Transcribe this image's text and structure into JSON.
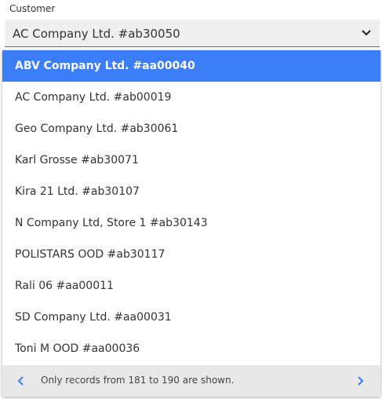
{
  "field": {
    "label": "Customer",
    "value": "AC Company Ltd. #ab30050"
  },
  "options": [
    {
      "label": "ABV Company Ltd. #aa00040",
      "selected": true
    },
    {
      "label": "AC Company Ltd. #ab00019",
      "selected": false
    },
    {
      "label": "Geo Company Ltd. #ab30061",
      "selected": false
    },
    {
      "label": "Karl Grosse #ab30071",
      "selected": false
    },
    {
      "label": "Kira 21 Ltd. #ab30107",
      "selected": false
    },
    {
      "label": "N Company Ltd, Store 1 #ab30143",
      "selected": false
    },
    {
      "label": "POLISTARS OOD #ab30117",
      "selected": false
    },
    {
      "label": "Rali 06 #aa00011",
      "selected": false
    },
    {
      "label": "SD Company Ltd. #aa00031",
      "selected": false
    },
    {
      "label": "Toni M OOD #aa00036",
      "selected": false
    }
  ],
  "footer": {
    "message": "Only records from 181 to 190 are shown."
  },
  "icons": {
    "dropdown": "chevron-down-icon",
    "prev": "chevron-left-icon",
    "next": "chevron-right-icon"
  },
  "colors": {
    "selected_bg": "#3b7cf7",
    "accent": "#3b7cf7"
  }
}
